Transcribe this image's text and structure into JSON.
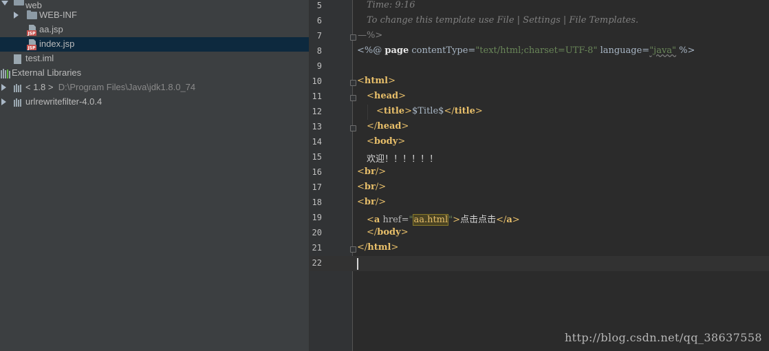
{
  "project_tree": {
    "items": [
      {
        "label": "web",
        "icon": "folder-icon",
        "expanded": true
      },
      {
        "label": "WEB-INF",
        "icon": "folder-icon",
        "expanded": false
      },
      {
        "label": "aa.jsp",
        "icon": "jsp-file-icon"
      },
      {
        "label": "index.jsp",
        "icon": "jsp-file-icon",
        "selected": true
      },
      {
        "label": "test.iml",
        "icon": "iml-file-icon"
      },
      {
        "label": "External Libraries",
        "icon": "library-icon"
      },
      {
        "label": "< 1.8 >",
        "extra": "D:\\Program Files\\Java\\jdk1.8.0_74",
        "icon": "jdk-icon",
        "expanded": false
      },
      {
        "label": "urlrewritefilter-4.0.4",
        "icon": "jar-library-icon",
        "expanded": false
      }
    ]
  },
  "editor": {
    "line_numbers": [
      "5",
      "6",
      "7",
      "8",
      "9",
      "10",
      "11",
      "12",
      "13",
      "14",
      "15",
      "16",
      "17",
      "18",
      "19",
      "20",
      "21",
      "22"
    ],
    "lines": {
      "l5": {
        "comment": "Time: 9:16"
      },
      "l6": {
        "comment": "To change this template use File | Settings | File Templates."
      },
      "l7": {
        "comment_end": "—%>"
      },
      "l8": {
        "open": "<%@ ",
        "kw": "page",
        "attr1": " contentType=",
        "val1": "\"text/html;charset=UTF-8\"",
        "attr2": " language=",
        "val2": "\"java\"",
        "close": " %>"
      },
      "l10": {
        "lt": "<",
        "tag": "html",
        "gt": ">"
      },
      "l11": {
        "lt": "<",
        "tag": "head",
        "gt": ">"
      },
      "l12": {
        "lt": "<",
        "tag": "title",
        "gt": ">",
        "text": "$Title$",
        "lt2": "</",
        "tag2": "title",
        "gt2": ">"
      },
      "l13": {
        "lt": "</",
        "tag": "head",
        "gt": ">"
      },
      "l14": {
        "lt": "<",
        "tag": "body",
        "gt": ">"
      },
      "l15": {
        "text": "欢迎！！！！！！"
      },
      "l16": {
        "lt": "<",
        "tag": "br",
        "gt": "/>"
      },
      "l17": {
        "lt": "<",
        "tag": "br",
        "gt": "/>"
      },
      "l18": {
        "lt": "<",
        "tag": "br",
        "gt": "/>"
      },
      "l19": {
        "lt": "<",
        "tag": "a",
        "attr": " href=",
        "q1": "\"",
        "val": "aa.html",
        "q2": "\"",
        "gt": ">",
        "text": "点击点击",
        "lt2": "</",
        "tag2": "a",
        "gt2": ">"
      },
      "l20": {
        "lt": "</",
        "tag": "body",
        "gt": ">"
      },
      "l21": {
        "lt": "</",
        "tag": "html",
        "gt": ">"
      }
    }
  },
  "watermark": "http://blog.csdn.net/qq_38637558",
  "colors": {
    "tree_bg": "#3c3f41",
    "selection_bg": "#0d293e",
    "editor_bg": "#2b2b2b",
    "tag": "#e8bf6a",
    "string": "#6a8759",
    "comment": "#808080"
  }
}
